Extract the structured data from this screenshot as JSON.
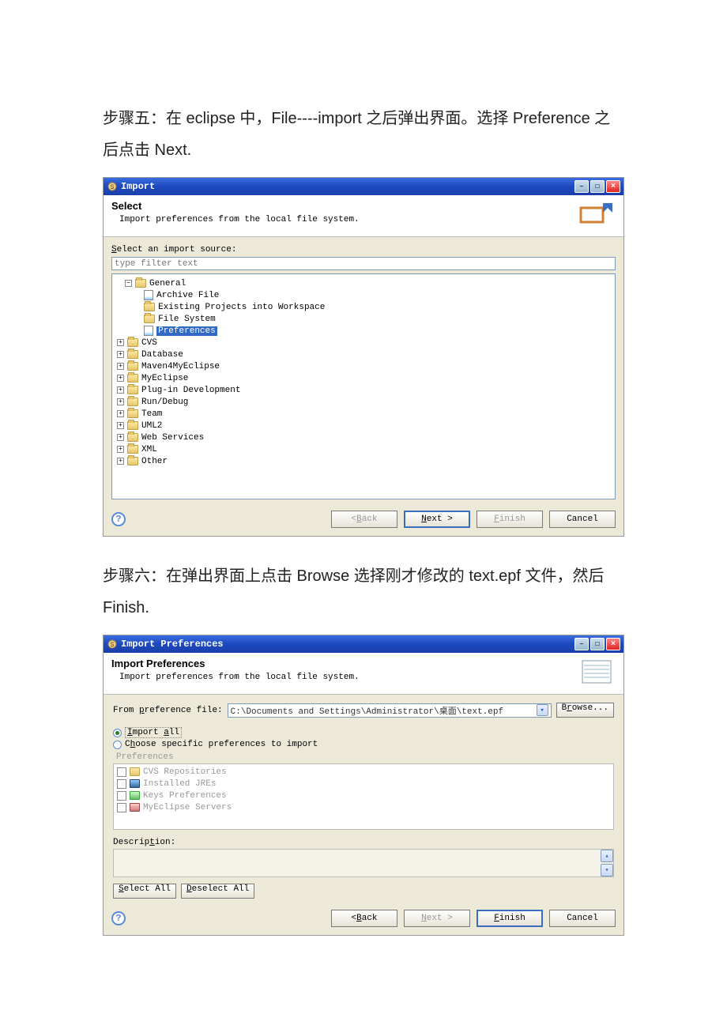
{
  "step5": "步骤五：在 eclipse 中，File----import 之后弹出界面。选择 Preference 之后点击 Next.",
  "step6": "步骤六：在弹出界面上点击 Browse 选择刚才修改的 text.epf 文件，然后 Finish.",
  "dialog1": {
    "title": "Import",
    "header_title": "Select",
    "header_desc": "Import preferences from the local file system.",
    "source_label": "Select an import source:",
    "filter_placeholder": "type filter text",
    "tree": {
      "general": "General",
      "archive": "Archive File",
      "existing": "Existing Projects into Workspace",
      "filesys": "File System",
      "prefs": "Preferences",
      "cvs": "CVS",
      "database": "Database",
      "maven": "Maven4MyEclipse",
      "myeclipse": "MyEclipse",
      "plugin": "Plug-in Development",
      "rundebug": "Run/Debug",
      "team": "Team",
      "uml2": "UML2",
      "webserv": "Web Services",
      "xml": "XML",
      "other": "Other"
    },
    "btn_back": "< Back",
    "btn_next": "Next >",
    "btn_finish": "Finish",
    "btn_cancel": "Cancel"
  },
  "dialog2": {
    "title": "Import Preferences",
    "header_title": "Import Preferences",
    "header_desc": "Import preferences from the local file system.",
    "from_label": "From preference file:",
    "from_value": "C:\\Documents and Settings\\Administrator\\桌面\\text.epf",
    "browse": "Browse...",
    "import_all": "Import all",
    "choose_specific": "Choose specific preferences to import",
    "prefs_label": "Preferences",
    "items": {
      "cvs": "CVS Repositories",
      "jres": "Installed JREs",
      "keys": "Keys Preferences",
      "servers": "MyEclipse Servers"
    },
    "desc_label": "Description:",
    "select_all": "Select All",
    "deselect_all": "Deselect All",
    "btn_back": "< Back",
    "btn_next": "Next >",
    "btn_finish": "Finish",
    "btn_cancel": "Cancel"
  }
}
